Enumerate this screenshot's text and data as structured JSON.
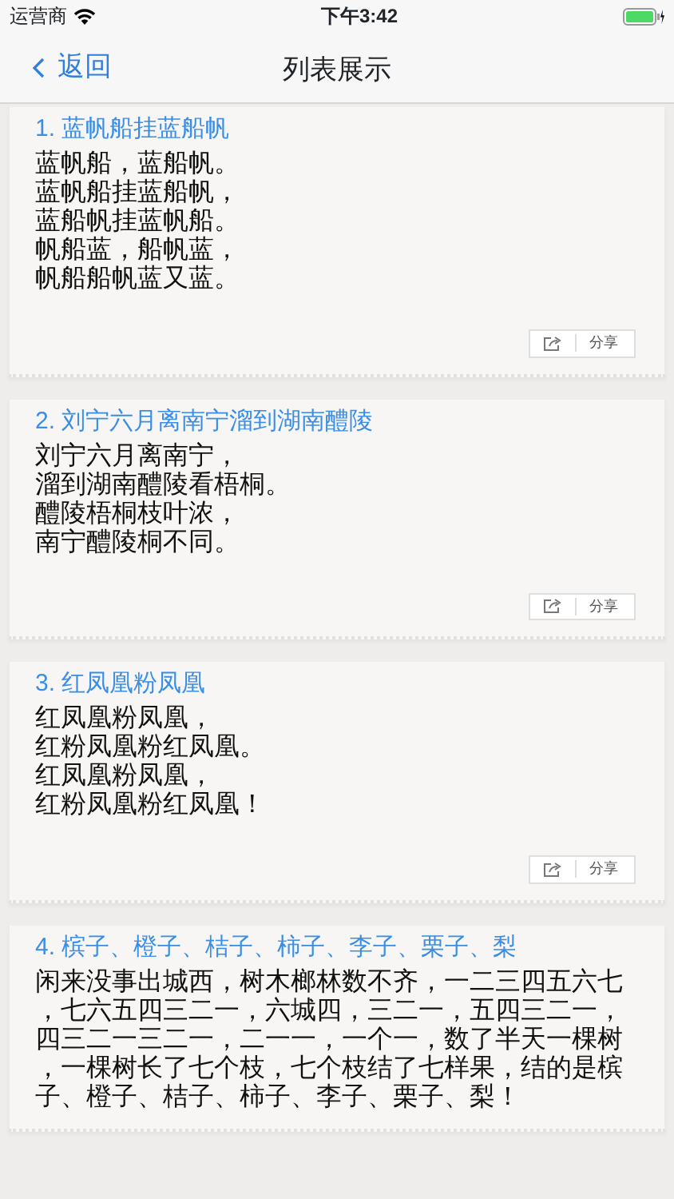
{
  "status_bar": {
    "carrier": "运营商",
    "time": "下午3:42"
  },
  "nav": {
    "back": "返回",
    "title": "列表展示"
  },
  "items": [
    {
      "title": "1. 蓝帆船挂蓝船帆",
      "lines": [
        "蓝帆船，蓝船帆。",
        "蓝帆船挂蓝船帆，",
        "蓝船帆挂蓝帆船。",
        "帆船蓝，船帆蓝，",
        "帆船船帆蓝又蓝。"
      ],
      "share": "分享"
    },
    {
      "title": "2. 刘宁六月离南宁溜到湖南醴陵",
      "lines": [
        "刘宁六月离南宁，",
        "溜到湖南醴陵看梧桐。",
        "醴陵梧桐枝叶浓，",
        "南宁醴陵桐不同。"
      ],
      "share": "分享"
    },
    {
      "title": "3. 红凤凰粉凤凰",
      "lines": [
        "红凤凰粉凤凰，",
        "红粉凤凰粉红凤凰。",
        "红凤凰粉凤凰，",
        "红粉凤凰粉红凤凰！"
      ],
      "share": "分享"
    },
    {
      "title": "4. 槟子、橙子、桔子、柿子、李子、栗子、梨",
      "lines": [
        "闲来没事出城西，树木榔林数不齐，一二三四五六七",
        "，七六五四三二一，六城四，三二一，五四三二一，",
        "四三二一三二一，二一一，一个一，数了半天一棵树",
        "，一棵树长了七个枝，七个枝结了七样果，结的是槟",
        "子、橙子、桔子、柿子、李子、栗子、梨！"
      ]
    }
  ]
}
